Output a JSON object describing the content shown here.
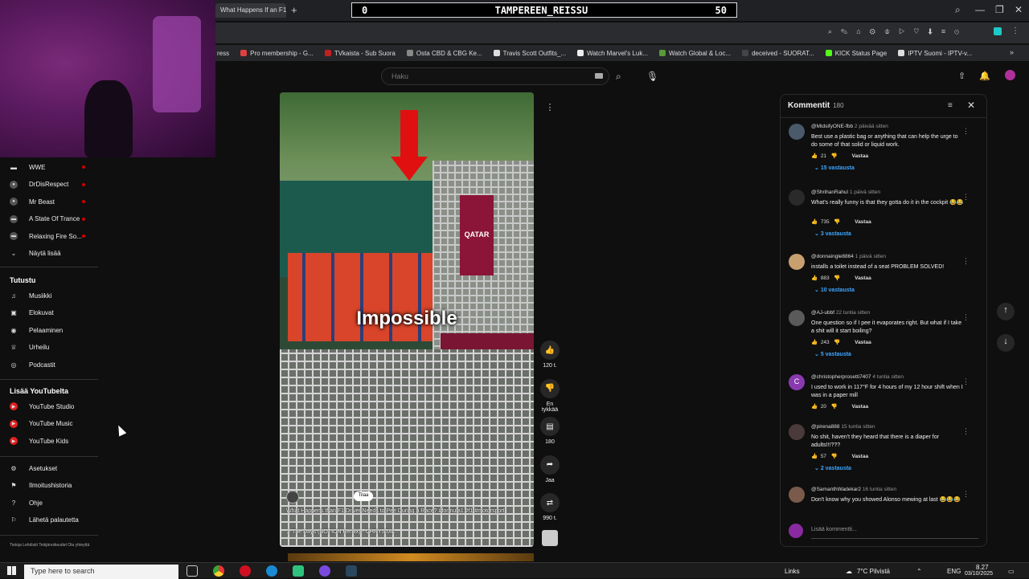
{
  "browser": {
    "tab_title": "What Happens If an F1",
    "overlay": {
      "left": "0",
      "title": "TAMPEREEN_REISSU",
      "right": "50"
    },
    "bookmarks": [
      {
        "label": "ress",
        "color": ""
      },
      {
        "label": "Pro membership - G...",
        "color": "#e04040"
      },
      {
        "label": "TVkaista - Sub Suora",
        "color": "#c02020"
      },
      {
        "label": "Osta CBD & CBG Ke...",
        "color": "#888888"
      },
      {
        "label": "Travis Scott Outfits_...",
        "color": "#dddddd"
      },
      {
        "label": "Watch Marvel's Luk...",
        "color": "#eeeeee"
      },
      {
        "label": "Watch Global & Loc...",
        "color": "#5a9a3a"
      },
      {
        "label": "deceived - SUORAT...",
        "color": "#444444"
      },
      {
        "label": "KICK Status Page",
        "color": "#53fc18"
      },
      {
        "label": "IPTV Suomi - IPTV-v...",
        "color": "#dddddd"
      }
    ]
  },
  "sidebar": {
    "subscriptions": [
      {
        "label": "WWE",
        "icon": "wwe-icon"
      },
      {
        "label": "DrDisRespect",
        "icon": "channel-avatar"
      },
      {
        "label": "Mr Beast",
        "icon": "channel-avatar"
      },
      {
        "label": "A State Of Trance",
        "icon": "channel-avatar"
      },
      {
        "label": "Relaxing Fire So...",
        "icon": "channel-avatar"
      },
      {
        "label": "Näytä lisää",
        "icon": "chevron-down-icon"
      }
    ],
    "explore_title": "Tutustu",
    "explore": [
      {
        "label": "Musiikki",
        "glyph": "♫"
      },
      {
        "label": "Elokuvat",
        "glyph": "▣"
      },
      {
        "label": "Pelaaminen",
        "glyph": "◉"
      },
      {
        "label": "Urheilu",
        "glyph": "♕"
      },
      {
        "label": "Podcastit",
        "glyph": "◎"
      }
    ],
    "more_title": "Lisää YouTubelta",
    "more": [
      {
        "label": "YouTube Studio"
      },
      {
        "label": "YouTube Music"
      },
      {
        "label": "YouTube Kids"
      }
    ],
    "settings": [
      {
        "label": "Asetukset",
        "glyph": "⚙"
      },
      {
        "label": "Ilmoitushistoria",
        "glyph": "⚑"
      },
      {
        "label": "Ohje",
        "glyph": "?"
      },
      {
        "label": "Lähetä palautetta",
        "glyph": "⚐"
      }
    ],
    "footer": "Tietoja  Lehdistö  Tekijänoikeudet  Ota yhteyttä"
  },
  "search": {
    "placeholder": "Haku"
  },
  "video": {
    "caption": "Impossible",
    "meta_line": "What Happens If an F1 Driver Needs to Pee During a Race? #formula1 #f1 #motorsport",
    "sound": "♫ The Days (NOTION Remix) · CHRYSTAL",
    "subscribe": "Tilaa",
    "actions": [
      {
        "name": "like",
        "glyph": "👍",
        "label": "120 t."
      },
      {
        "name": "dislike",
        "glyph": "👎",
        "label": "En tykkää"
      },
      {
        "name": "comments",
        "glyph": "▤",
        "label": "180"
      },
      {
        "name": "share",
        "glyph": "➦",
        "label": "Jaa"
      },
      {
        "name": "remix",
        "glyph": "⇄",
        "label": "990 t."
      }
    ]
  },
  "comments": {
    "title": "Kommentit",
    "count": "180",
    "add_placeholder": "Lisää kommentti...",
    "reply_label": "Vastaa",
    "items": [
      {
        "author": "@MidsifyONE-fbb",
        "time": "2 päivää sitten",
        "text": "Best use a plastic bag or anything that can help the urge to do some of that solid or liquid work.",
        "likes": "21",
        "replies": "15 vastausta",
        "avatar_color": "#4a5a6a",
        "initial": ""
      },
      {
        "author": "@ShrihanRahul",
        "time": "1 päivä sitten",
        "text": "What's really funny is that they gotta do it in the cockpit 😂😂",
        "likes": "735",
        "replies": "3 vastausta",
        "avatar_color": "#2a2a2a",
        "initial": ""
      },
      {
        "author": "@donnaingle8864",
        "time": "1 päivä sitten",
        "text": "installs a toilet instead of a seat PROBLEM SOLVED!",
        "likes": "883",
        "replies": "10 vastausta",
        "avatar_color": "#c8a070",
        "initial": ""
      },
      {
        "author": "@AJ-ubbf",
        "time": "22 tuntia sitten",
        "text": "One question so if I pee it evaporates right. But what if I take a shit will it start boiling?",
        "likes": "243",
        "replies": "5 vastausta",
        "avatar_color": "#5a5a5a",
        "initial": ""
      },
      {
        "author": "@christopherprosetti7407",
        "time": "4 tuntia sitten",
        "text": "I used to work in 117°F for 4 hours of my 12 hour shift when I was in a paper mill",
        "likes": "20",
        "replies": "",
        "avatar_color": "#8a3ab0",
        "initial": "C"
      },
      {
        "author": "@pirena888",
        "time": "15 tuntia sitten",
        "text": "No shit, haven't they heard that there is a diaper for adults!!!???",
        "likes": "57",
        "replies": "2 vastausta",
        "avatar_color": "#4a3a3a",
        "initial": ""
      },
      {
        "author": "@SamanthWadekar2",
        "time": "16 tuntia sitten",
        "text": "Don't know why you showed Alonso mewing at last 😂😂😂",
        "likes": "",
        "replies": "",
        "avatar_color": "#7a5a4a",
        "initial": ""
      }
    ]
  },
  "taskbar": {
    "search_placeholder": "Type here to search",
    "links": "Links",
    "weather": "7°C  Pilvistä",
    "lang": "ENG",
    "time": "8.27",
    "date": "03/10/2025"
  }
}
